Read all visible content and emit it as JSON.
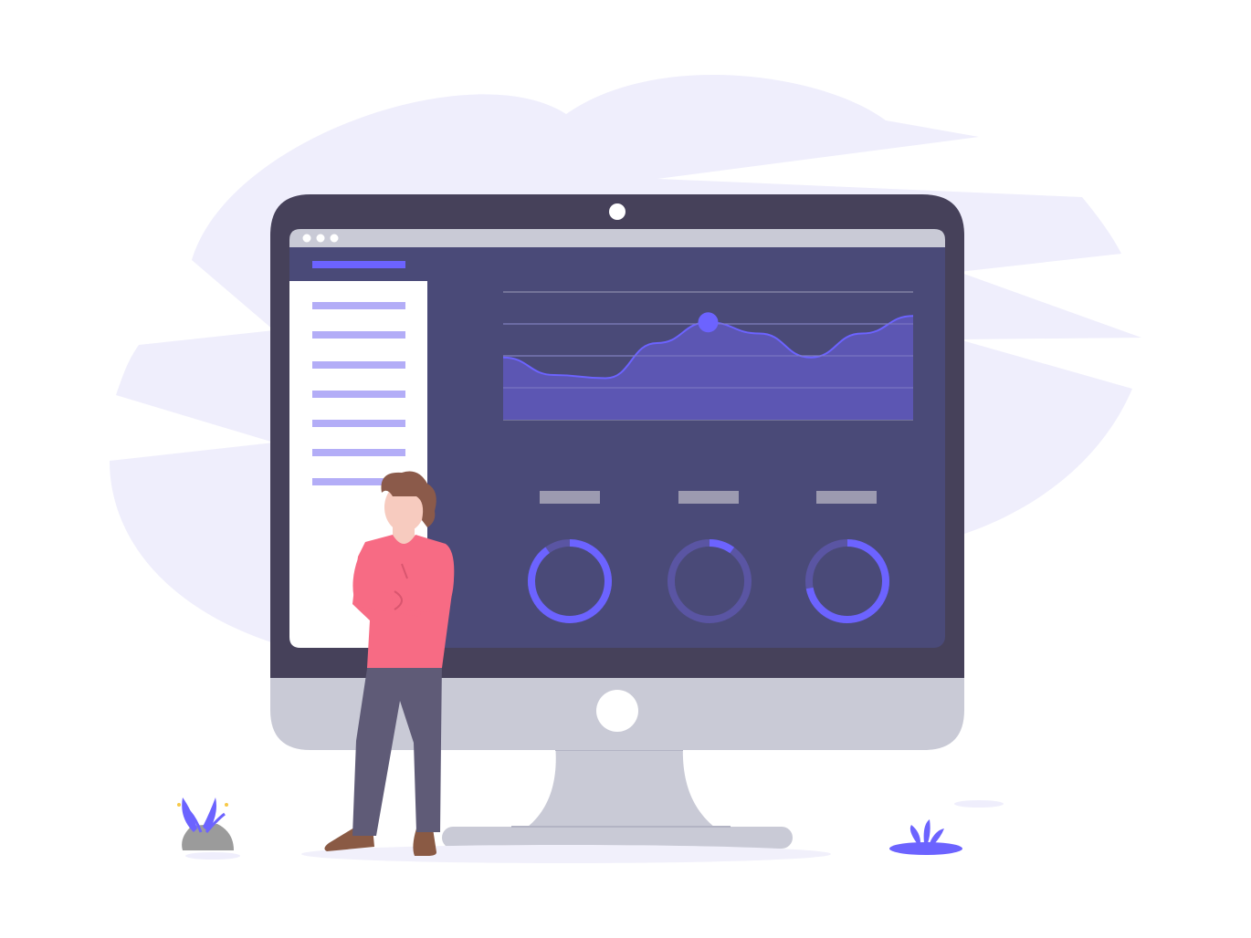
{
  "colors": {
    "background": "#ffffff",
    "blob": "#efeefc",
    "monitor_frame": "#46415a",
    "monitor_chin": "#c9cad6",
    "screen_bg": "#4a4a78",
    "titlebar": "#c9cad6",
    "sidebar_bg": "#ffffff",
    "accent": "#6c63ff",
    "sidebar_item": "#b3adf7",
    "chart_fill": "#5d56b6",
    "gridline": "#8c8cab",
    "label_placeholder": "#9c9ab0",
    "ring_track": "#5a55a3",
    "shirt": "#f76b84",
    "pants": "#5f5b77",
    "shoes": "#8a5a44",
    "hair": "#8b5a4a",
    "skin": "#f7cbbf",
    "rock": "#9b9b9b"
  },
  "icons": {
    "camera": "camera-dot-icon",
    "window_controls": "window-controls-icon",
    "home_button": "monitor-logo-icon",
    "chart_marker": "chart-point-icon"
  },
  "chart_data": {
    "type": "area",
    "x": [
      0,
      1,
      2,
      3,
      4,
      5,
      6,
      7,
      8
    ],
    "values": [
      1.95,
      1.4,
      1.3,
      2.4,
      3.05,
      2.7,
      1.95,
      2.7,
      3.25
    ],
    "highlight_index": 4,
    "ylim": [
      0,
      4
    ],
    "grid": true,
    "title": "",
    "xlabel": "",
    "ylabel": ""
  },
  "gauges": [
    {
      "value": 0.9
    },
    {
      "value": 0.1
    },
    {
      "value": 0.72
    }
  ],
  "sidebar": {
    "items_count_label": ""
  }
}
